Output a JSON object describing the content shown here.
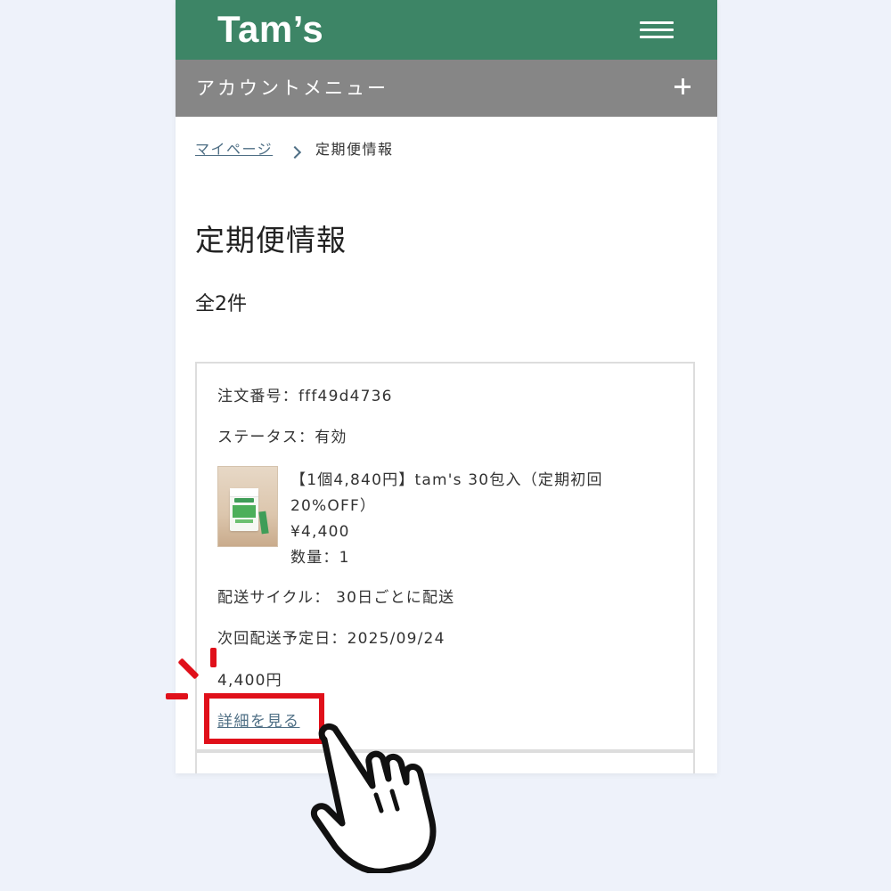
{
  "header": {
    "logo": "Tam’s",
    "menu_icon": "hamburger-menu-icon"
  },
  "account_menu": {
    "label": "アカウントメニュー",
    "expand_icon": "plus-icon"
  },
  "breadcrumb": {
    "home": "マイページ",
    "current": "定期便情報"
  },
  "page": {
    "title": "定期便情報",
    "count": "全2件"
  },
  "subscription": {
    "order_number": "注文番号：fff49d4736",
    "status": "ステータス：有効",
    "product": {
      "name_line1": "【1個4,840円】tam's 30包入（定期初回",
      "name_line2": "20%OFF）",
      "price": "¥4,400",
      "quantity": "数量：1"
    },
    "delivery_cycle": "配送サイクル： 30日ごとに配送",
    "next_delivery": "次回配送予定日：2025/09/24",
    "total": "4,400円",
    "detail_link": "詳細を見る"
  },
  "colors": {
    "header_bg": "#3d8566",
    "account_bar_bg": "#868686",
    "link": "#4f6f85",
    "highlight": "#e0101a",
    "page_bg": "#eef2fa"
  }
}
